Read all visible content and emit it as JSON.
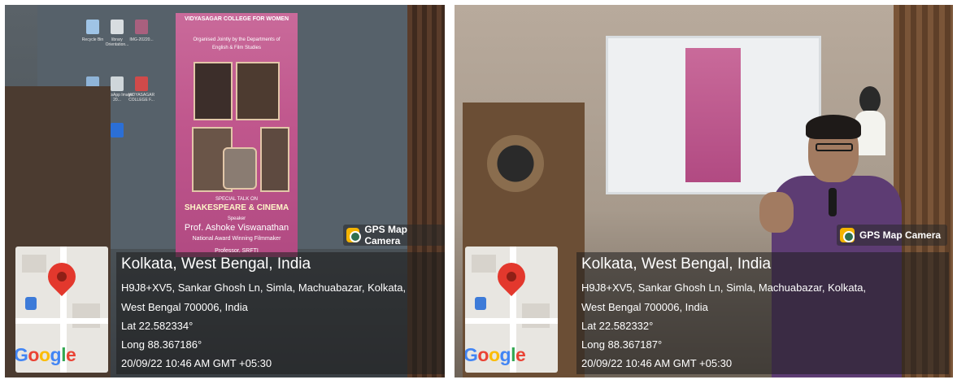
{
  "photos": [
    {
      "id": "left",
      "poster": {
        "college": "VIDYASAGAR COLLEGE FOR WOMEN",
        "organised": "Organised Jointly by the Departments of",
        "departments": "English & Film Studies",
        "talk": "SPECIAL TALK ON",
        "title": "SHAKESPEARE & CINEMA",
        "speaker_label": "Speaker",
        "speaker": "Prof. Ashoke Viswanathan",
        "role1": "National Award Winning Filmmaker",
        "role2": "Professor, SRFTI"
      },
      "desktop_icons": [
        "Recycle Bin",
        "library Orientation...",
        "IMG-20220...",
        "WhatsApp Image 20...",
        "VIDYASAGAR COLLEGE F..."
      ],
      "gps_tag": "GPS Map Camera",
      "location_title": "Kolkata, West Bengal, India",
      "address_line1": "H9J8+XV5, Sankar Ghosh Ln, Simla, Machuabazar, Kolkata,",
      "address_line2": "West Bengal 700006, India",
      "lat": "Lat 22.582334°",
      "long": "Long 88.367186°",
      "datetime": "20/09/22 10:46 AM GMT +05:30",
      "map_brand": "Google"
    },
    {
      "id": "right",
      "gps_tag": "GPS Map Camera",
      "location_title": "Kolkata, West Bengal, India",
      "address_line1": "H9J8+XV5, Sankar Ghosh Ln, Simla, Machuabazar, Kolkata,",
      "address_line2": "West Bengal 700006, India",
      "lat": "Lat 22.582332°",
      "long": "Long 88.367187°",
      "datetime": "20/09/22 10:46 AM GMT +05:30",
      "map_brand": "Google"
    }
  ],
  "colors": {
    "pin_red": "#e3382d",
    "google_blue": "#4285f4",
    "google_red": "#ea4335",
    "google_yellow": "#fbbc05",
    "google_green": "#34a853",
    "poster_pink": "#c0578d",
    "shirt_purple": "#5d3c73"
  }
}
